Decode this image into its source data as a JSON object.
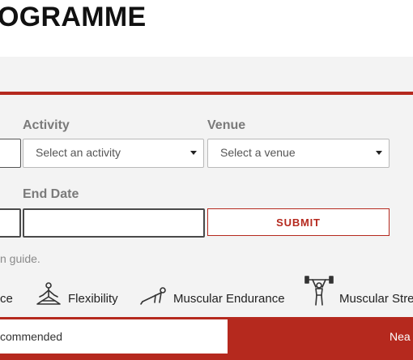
{
  "header": {
    "title": "OGRAMME"
  },
  "form": {
    "activity_label": "Activity",
    "venue_label": "Venue",
    "activity_select": "Select an activity",
    "venue_select": "Select a venue",
    "end_date_label": "End Date",
    "end_date_value": "",
    "submit_label": "SUBMIT"
  },
  "hint": "n guide.",
  "categories": [
    {
      "label": "ce",
      "icon": ""
    },
    {
      "label": "Flexibility",
      "icon": "yoga-pose-icon"
    },
    {
      "label": "Muscular Endurance",
      "icon": "pushup-icon"
    },
    {
      "label": "Muscular Stre",
      "icon": "weightlifter-icon"
    }
  ],
  "tabs": {
    "left": "commended",
    "right": "Nea"
  },
  "colors": {
    "accent": "#b5291e",
    "panel": "#f3f3f3"
  }
}
